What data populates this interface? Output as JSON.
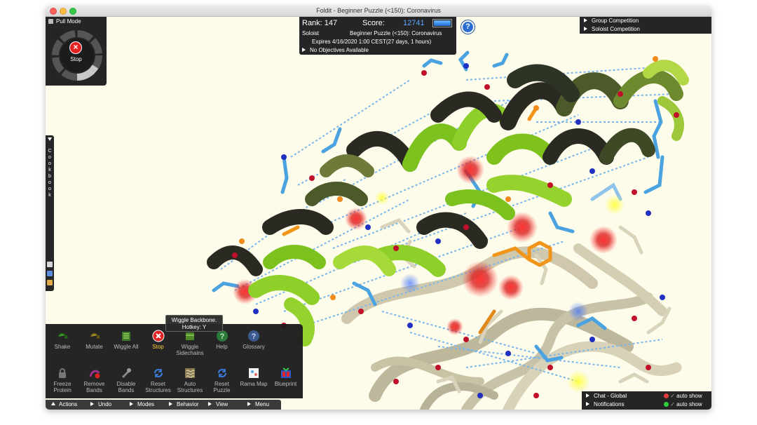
{
  "window": {
    "title": "Foldit - Beginner Puzzle (<150): Coronavirus"
  },
  "pull_mode": {
    "title": "Pull Mode",
    "stop_label": "Stop"
  },
  "score_panel": {
    "rank": "Rank: 147",
    "score_label": "Score:",
    "score_value": "12741",
    "mode": "Soloist",
    "puzzle": "Beginner Puzzle (<150): Coronavirus",
    "expires": "Expires 4/16/2020 1:00 CEST(27 days, 1 hours)",
    "objectives": "No Objectives Available"
  },
  "help": {
    "glyph": "?"
  },
  "competition": {
    "group": "Group Competition",
    "soloist": "Soloist Competition"
  },
  "cookbook": {
    "label": "Cookbook"
  },
  "tooltip": {
    "line1": "Wiggle Backbone.",
    "line2": "Hotkey: Y"
  },
  "actions": {
    "row1": [
      {
        "name": "shake",
        "label": "Shake",
        "icon": "shake-icon"
      },
      {
        "name": "mutate",
        "label": "Mutate",
        "icon": "mutate-icon"
      },
      {
        "name": "wiggle-all",
        "label": "Wiggle All",
        "icon": "wiggle-all-icon"
      },
      {
        "name": "stop",
        "label": "Stop",
        "icon": "stop-icon"
      },
      {
        "name": "wiggle-sidechains",
        "label": "Wiggle Sidechains",
        "icon": "wiggle-sidechains-icon"
      },
      {
        "name": "help",
        "label": "Help",
        "icon": "help-icon"
      },
      {
        "name": "glossary",
        "label": "Glossary",
        "icon": "glossary-icon"
      }
    ],
    "row2": [
      {
        "name": "freeze-protein",
        "label": "Freeze Protein",
        "icon": "lock-icon"
      },
      {
        "name": "remove-bands",
        "label": "Remove Bands",
        "icon": "remove-bands-icon"
      },
      {
        "name": "disable-bands",
        "label": "Disable Bands",
        "icon": "disable-bands-icon"
      },
      {
        "name": "reset-structures",
        "label": "Reset Structures",
        "icon": "refresh-icon"
      },
      {
        "name": "auto-structures",
        "label": "Auto Structures",
        "icon": "auto-structures-icon"
      },
      {
        "name": "reset-puzzle",
        "label": "Reset Puzzle",
        "icon": "refresh-icon"
      },
      {
        "name": "rama-map",
        "label": "Rama Map",
        "icon": "rama-map-icon"
      },
      {
        "name": "blueprint",
        "label": "Blueprint",
        "icon": "blueprint-icon"
      }
    ]
  },
  "tabs": [
    "Actions",
    "Undo",
    "Modes",
    "Behavior",
    "View",
    "Menu"
  ],
  "chat": {
    "chat_label": "Chat - Global",
    "notifications_label": "Notifications",
    "auto_show": "auto show",
    "chat_status_color": "#e23b3b",
    "notif_status_color": "#2fd03a"
  },
  "colors": {
    "canvas_bg": "#fdfbe9",
    "helix_green": "#8fcf2a",
    "helix_dark": "#2a2a22",
    "sidechain_blue": "#4aa3e0",
    "score_blue": "#5aa8ff",
    "stop_red": "#e02222"
  }
}
